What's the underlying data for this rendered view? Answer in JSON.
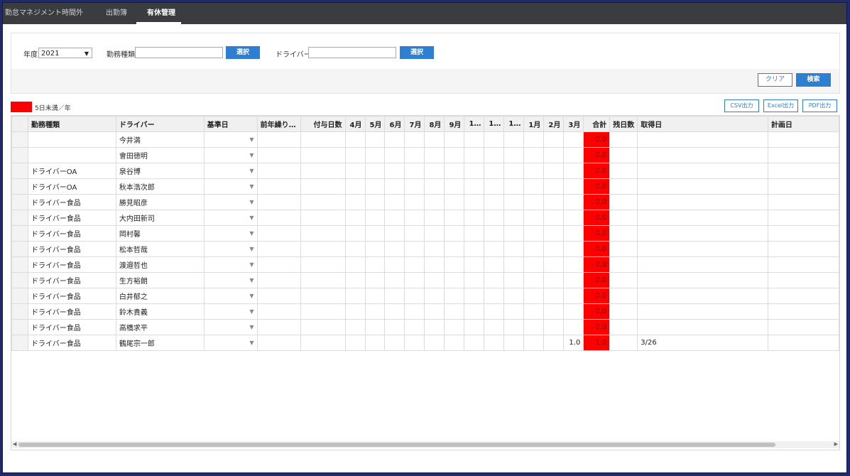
{
  "nav": {
    "tabs": [
      {
        "label": "勤怠マネジメント"
      },
      {
        "label": "時間外"
      },
      {
        "label": "出勤簿"
      },
      {
        "label": "有休管理"
      }
    ]
  },
  "filters": {
    "year_label": "年度",
    "year_value": "2021",
    "work_type_label": "勤務種類",
    "work_type_value": "",
    "select_button": "選択",
    "driver_label": "ドライバー",
    "driver_value": "",
    "clear_button": "クリア",
    "search_button": "検索"
  },
  "legend": {
    "text": "5日未満／年",
    "color": "#ff0000"
  },
  "export": {
    "csv": "CSV出力",
    "excel": "Excel出力",
    "pdf": "PDF出力"
  },
  "table": {
    "columns": [
      "勤務種類",
      "ドライバー",
      "基準日",
      "前年繰り…",
      "付与日数",
      "4月",
      "5月",
      "6月",
      "7月",
      "8月",
      "9月",
      "1…",
      "1…",
      "1…",
      "1月",
      "2月",
      "3月",
      "合計",
      "残日数",
      "取得日",
      "計画日"
    ],
    "rows": [
      {
        "type": "",
        "driver": "今井満",
        "mar": "",
        "total": "0.0",
        "acquired": ""
      },
      {
        "type": "",
        "driver": "會田徳明",
        "mar": "",
        "total": "0.0",
        "acquired": ""
      },
      {
        "type": "ドライバーOA",
        "driver": "泉谷博",
        "mar": "",
        "total": "0.0",
        "acquired": ""
      },
      {
        "type": "ドライバーOA",
        "driver": "秋本浩次郎",
        "mar": "",
        "total": "0.0",
        "acquired": ""
      },
      {
        "type": "ドライバー食品",
        "driver": "勝見昭彦",
        "mar": "",
        "total": "0.0",
        "acquired": ""
      },
      {
        "type": "ドライバー食品",
        "driver": "大内田新司",
        "mar": "",
        "total": "0.0",
        "acquired": ""
      },
      {
        "type": "ドライバー食品",
        "driver": "岡村馨",
        "mar": "",
        "total": "0.0",
        "acquired": ""
      },
      {
        "type": "ドライバー食品",
        "driver": "松本哲哉",
        "mar": "",
        "total": "0.0",
        "acquired": ""
      },
      {
        "type": "ドライバー食品",
        "driver": "渡邉哲也",
        "mar": "",
        "total": "0.0",
        "acquired": ""
      },
      {
        "type": "ドライバー食品",
        "driver": "生方裕朗",
        "mar": "",
        "total": "0.0",
        "acquired": ""
      },
      {
        "type": "ドライバー食品",
        "driver": "白井郁之",
        "mar": "",
        "total": "0.0",
        "acquired": ""
      },
      {
        "type": "ドライバー食品",
        "driver": "鈴木貴義",
        "mar": "",
        "total": "0.0",
        "acquired": ""
      },
      {
        "type": "ドライバー食品",
        "driver": "高橋求平",
        "mar": "",
        "total": "0.0",
        "acquired": ""
      },
      {
        "type": "ドライバー食品",
        "driver": "鶴尾宗一郎",
        "mar": "1.0",
        "total": "1.0",
        "acquired": "3/26"
      }
    ]
  }
}
